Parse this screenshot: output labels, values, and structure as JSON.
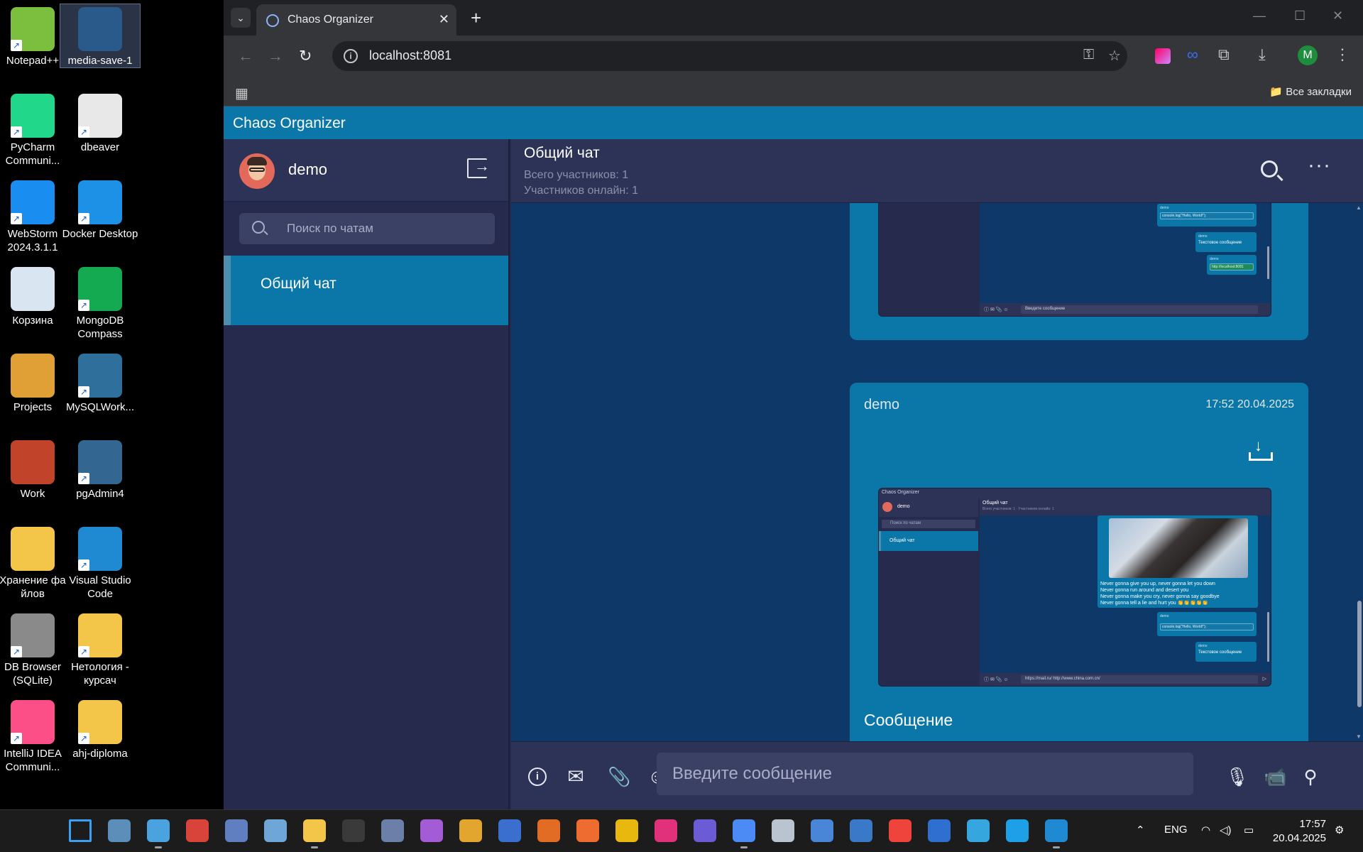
{
  "desktop": {
    "icons": [
      {
        "label": "Notepad++",
        "color": "#7cbf3f"
      },
      {
        "label": "media-save-1",
        "color": "#2a5a8a"
      },
      {
        "label": "PyCharm Communi...",
        "color": "#21d789"
      },
      {
        "label": "dbeaver",
        "color": "#e8e8e8"
      },
      {
        "label": "WebStorm 2024.3.1.1",
        "color": "#1a8ef0"
      },
      {
        "label": "Docker Desktop",
        "color": "#1d91e6"
      },
      {
        "label": "Корзина",
        "color": "#d9e6f2"
      },
      {
        "label": "MongoDB Compass",
        "color": "#13aa52"
      },
      {
        "label": "Projects",
        "color": "#e0a035"
      },
      {
        "label": "MySQLWork...",
        "color": "#2f6f9c"
      },
      {
        "label": "Work",
        "color": "#c0432a"
      },
      {
        "label": "pgAdmin4",
        "color": "#336791"
      },
      {
        "label": "Хранение фа йлов",
        "color": "#f3c64a"
      },
      {
        "label": "Visual Studio Code",
        "color": "#1f8ad2"
      },
      {
        "label": "DB Browser (SQLite)",
        "color": "#8a8a8a"
      },
      {
        "label": "Нетология - курсач",
        "color": "#f3c64a"
      },
      {
        "label": "IntelliJ IDEA Communi...",
        "color": "#fc4f88"
      },
      {
        "label": "ahj-diploma",
        "color": "#f3c64a"
      }
    ]
  },
  "browser": {
    "tab_title": "Chaos Organizer",
    "url": "localhost:8081",
    "profile_initial": "M",
    "all_bookmarks": "Все закладки"
  },
  "app": {
    "title": "Chaos Organizer",
    "user": {
      "name": "demo"
    },
    "search_placeholder": "Поиск по чатам",
    "chats": [
      {
        "name": "Общий чат"
      }
    ],
    "chat_header": {
      "title": "Общий чат",
      "total_members": "Всего участников:   1",
      "online_members": "Участников онлайн:   1"
    },
    "messages": [
      {
        "author": "demo",
        "time": "17:52 20.04.2025",
        "text": "Сообщение"
      }
    ],
    "input_placeholder": "Введите сообщение"
  },
  "preview": {
    "app_title": "Chaos Organizer",
    "user": "demo",
    "search": "Поиск по чатам",
    "chat": "Общий чат",
    "chat_sub": "Всего участников: 1 · Участников онлайн: 1",
    "lyrics": [
      "Never gonna give you up, never gonna let you down",
      "Never gonna run around and desert you",
      "Never gonna make you cry, never gonna say goodbye",
      "Never gonna tell a lie and hurt you 👏👏👏👏👏"
    ],
    "code_author": "demo",
    "code_time": "17:52 20.04.2025",
    "code": "console.log(\"Hello, World!\");",
    "text_author": "demo",
    "text_time": "17:52 20.04.2025",
    "text_msg": "Текстовое сообщение",
    "link_msg": "http://localhost:8081",
    "input_text": "https://mail.ru/ http://www.china.com.cn/",
    "input_placeholder": "Введите сообщение"
  },
  "taskbar": {
    "lang": "ENG",
    "time": "17:57",
    "date": "20.04.2025",
    "apps": [
      {
        "name": "start",
        "color": "#3aa0f3"
      },
      {
        "name": "computer",
        "color": "#5b8fb9"
      },
      {
        "name": "notepad",
        "color": "#4aa3df"
      },
      {
        "name": "snipping",
        "color": "#d9443a"
      },
      {
        "name": "remote",
        "color": "#5f7fc0"
      },
      {
        "name": "photos",
        "color": "#6fa6d8"
      },
      {
        "name": "explorer",
        "color": "#f3c64a"
      },
      {
        "name": "terminal",
        "color": "#3a3a3a"
      },
      {
        "name": "lock",
        "color": "#6c7fa8"
      },
      {
        "name": "feather",
        "color": "#a45bd6"
      },
      {
        "name": "chrome-canary",
        "color": "#e2a52e"
      },
      {
        "name": "r-app",
        "color": "#3a6fd0"
      },
      {
        "name": "office",
        "color": "#e36c24"
      },
      {
        "name": "postman",
        "color": "#ef6c30"
      },
      {
        "name": "coin",
        "color": "#e8b80e"
      },
      {
        "name": "jetbrains",
        "color": "#e0317a"
      },
      {
        "name": "notes",
        "color": "#6b5cd6"
      },
      {
        "name": "chrome",
        "color": "#4c8bf5"
      },
      {
        "name": "sphere",
        "color": "#b9c4d0"
      },
      {
        "name": "shield",
        "color": "#4a86d8"
      },
      {
        "name": "network",
        "color": "#3a78c8"
      },
      {
        "name": "anydesk",
        "color": "#ef443b"
      },
      {
        "name": "vpn",
        "color": "#2f6fd0"
      },
      {
        "name": "telegram",
        "color": "#35a6de"
      },
      {
        "name": "skype",
        "color": "#1ea0e8"
      },
      {
        "name": "vscode",
        "color": "#1f8ad2"
      }
    ]
  }
}
